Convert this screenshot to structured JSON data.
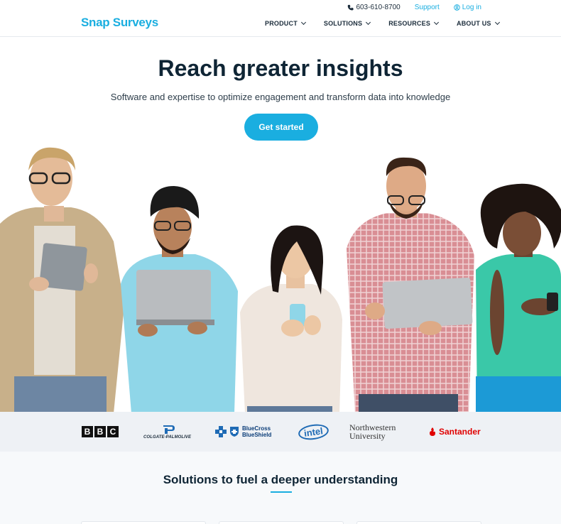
{
  "header": {
    "logo_text": "Snap Surveys",
    "phone": "603-610-8700",
    "support": "Support",
    "login": "Log in",
    "nav": [
      {
        "label": "PRODUCT"
      },
      {
        "label": "SOLUTIONS"
      },
      {
        "label": "RESOURCES"
      },
      {
        "label": "ABOUT US"
      }
    ]
  },
  "hero": {
    "title": "Reach greater insights",
    "subtitle": "Software and expertise to optimize engagement and transform data into knowledge",
    "cta_label": "Get started"
  },
  "logos": {
    "bbc": [
      "B",
      "B",
      "C"
    ],
    "colgate": "COLGATE-PALMOLIVE",
    "bcbs_line1": "BlueCross",
    "bcbs_line2": "BlueShield",
    "intel": "intel",
    "nwu_line1": "Northwestern",
    "nwu_line2": "University",
    "santander": "Santander"
  },
  "solutions": {
    "title": "Solutions to fuel a deeper understanding"
  },
  "colors": {
    "accent": "#1aaee0",
    "heading": "#0f2535",
    "strip_bg": "#eef1f5"
  }
}
